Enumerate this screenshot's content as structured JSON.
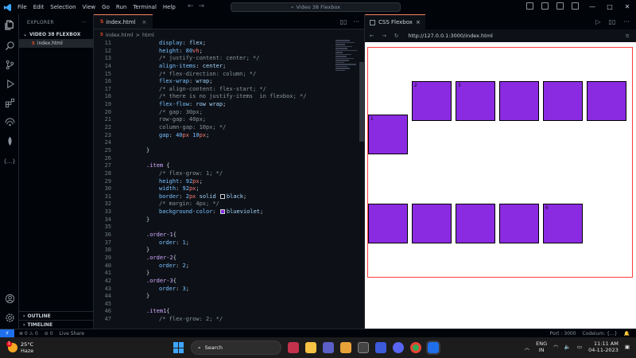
{
  "titlebar": {
    "menu": [
      "File",
      "Edit",
      "Selection",
      "View",
      "Go",
      "Run",
      "Terminal",
      "Help"
    ],
    "search_text": "Video 38 Flexbox",
    "nav_back": "←",
    "nav_forward": "→",
    "min_label": "—",
    "max_label": "□",
    "close_label": "✕"
  },
  "sidebar": {
    "header": "EXPLORER",
    "more": "···",
    "folder": "VIDEO 38 FLEXBOX",
    "file": "index.html",
    "file_badge": "5",
    "outline": "OUTLINE",
    "timeline": "TIMELINE"
  },
  "editor": {
    "tab_name": "index.html",
    "tab_close": "×",
    "tab_badge": "5",
    "crumb_file": "index.html",
    "crumb_sep": ">",
    "crumb_node": "html",
    "lines": [
      {
        "n": "11",
        "ind": 1,
        "parts": [
          [
            "prop",
            "display"
          ],
          [
            "pun",
            ": "
          ],
          [
            "val",
            "flex"
          ],
          [
            "pun",
            ";"
          ]
        ]
      },
      {
        "n": "12",
        "ind": 1,
        "parts": [
          [
            "prop",
            "height"
          ],
          [
            "pun",
            ": "
          ],
          [
            "num",
            "80"
          ],
          [
            "unit",
            "vh"
          ],
          [
            "pun",
            ";"
          ]
        ]
      },
      {
        "n": "13",
        "ind": 1,
        "parts": [
          [
            "cmt",
            "/* justify-content: center; */"
          ]
        ]
      },
      {
        "n": "14",
        "ind": 1,
        "parts": [
          [
            "prop",
            "align-items"
          ],
          [
            "pun",
            ": "
          ],
          [
            "val",
            "center"
          ],
          [
            "pun",
            ";"
          ]
        ]
      },
      {
        "n": "15",
        "ind": 1,
        "parts": [
          [
            "cmt",
            "/* flex-direction: column; */"
          ]
        ]
      },
      {
        "n": "16",
        "ind": 1,
        "parts": [
          [
            "prop",
            "flex-wrap"
          ],
          [
            "pun",
            ": "
          ],
          [
            "val",
            "wrap"
          ],
          [
            "pun",
            ";"
          ]
        ]
      },
      {
        "n": "17",
        "ind": 1,
        "parts": [
          [
            "cmt",
            "/* align-content: flex-start; */"
          ]
        ]
      },
      {
        "n": "18",
        "ind": 1,
        "parts": [
          [
            "cmt",
            "/* there is no justify-items  in flexbox; */"
          ]
        ]
      },
      {
        "n": "19",
        "ind": 1,
        "parts": [
          [
            "prop",
            "flex-flow"
          ],
          [
            "pun",
            ": "
          ],
          [
            "val",
            "row wrap"
          ],
          [
            "pun",
            ";"
          ]
        ]
      },
      {
        "n": "20",
        "ind": 1,
        "parts": [
          [
            "cmt",
            "/* gap: 30px;"
          ]
        ]
      },
      {
        "n": "21",
        "ind": 1,
        "parts": [
          [
            "cmt",
            "row-gap: 40px;"
          ]
        ]
      },
      {
        "n": "22",
        "ind": 1,
        "parts": [
          [
            "cmt",
            "column-gap: 10px; */"
          ]
        ]
      },
      {
        "n": "23",
        "ind": 1,
        "parts": [
          [
            "prop",
            "gap"
          ],
          [
            "pun",
            ": "
          ],
          [
            "num",
            "40"
          ],
          [
            "unit",
            "px"
          ],
          [
            "pun",
            " "
          ],
          [
            "num",
            "10"
          ],
          [
            "unit",
            "px"
          ],
          [
            "pun",
            ";"
          ]
        ]
      },
      {
        "n": "24",
        "ind": 0,
        "parts": []
      },
      {
        "n": "25",
        "ind": 0,
        "parts": [
          [
            "pun",
            "}"
          ]
        ]
      },
      {
        "n": "26",
        "ind": 0,
        "parts": []
      },
      {
        "n": "27",
        "ind": 0,
        "parts": [
          [
            "sel",
            ".item"
          ],
          [
            "pun",
            " {"
          ]
        ]
      },
      {
        "n": "28",
        "ind": 1,
        "parts": [
          [
            "cmt",
            "/* flex-grow: 1; */"
          ]
        ]
      },
      {
        "n": "29",
        "ind": 1,
        "parts": [
          [
            "prop",
            "height"
          ],
          [
            "pun",
            ": "
          ],
          [
            "num",
            "92"
          ],
          [
            "unit",
            "px"
          ],
          [
            "pun",
            ";"
          ]
        ]
      },
      {
        "n": "30",
        "ind": 1,
        "parts": [
          [
            "prop",
            "width"
          ],
          [
            "pun",
            ": "
          ],
          [
            "num",
            "92"
          ],
          [
            "unit",
            "px"
          ],
          [
            "pun",
            ";"
          ]
        ]
      },
      {
        "n": "31",
        "ind": 1,
        "parts": [
          [
            "prop",
            "border"
          ],
          [
            "pun",
            ": "
          ],
          [
            "num",
            "2"
          ],
          [
            "unit",
            "px"
          ],
          [
            "pun",
            " "
          ],
          [
            "val",
            "solid "
          ],
          [
            "sw",
            "#000000"
          ],
          [
            "val",
            "black"
          ],
          [
            "pun",
            ";"
          ]
        ]
      },
      {
        "n": "32",
        "ind": 1,
        "parts": [
          [
            "cmt",
            "/* margin: 4px; */"
          ]
        ]
      },
      {
        "n": "33",
        "ind": 1,
        "parts": [
          [
            "prop",
            "background-color"
          ],
          [
            "pun",
            ": "
          ],
          [
            "sw",
            "#8a2be2"
          ],
          [
            "val",
            "blueviolet"
          ],
          [
            "pun",
            ";"
          ]
        ]
      },
      {
        "n": "34",
        "ind": 0,
        "parts": [
          [
            "pun",
            "}"
          ]
        ]
      },
      {
        "n": "35",
        "ind": 0,
        "parts": []
      },
      {
        "n": "36",
        "ind": 0,
        "parts": [
          [
            "sel",
            ".order-1"
          ],
          [
            "pun",
            "{"
          ]
        ]
      },
      {
        "n": "37",
        "ind": 1,
        "parts": [
          [
            "prop",
            "order"
          ],
          [
            "pun",
            ": "
          ],
          [
            "num",
            "1"
          ],
          [
            "pun",
            ";"
          ]
        ]
      },
      {
        "n": "38",
        "ind": 0,
        "parts": [
          [
            "pun",
            "}"
          ]
        ]
      },
      {
        "n": "39",
        "ind": 0,
        "parts": [
          [
            "sel",
            ".order-2"
          ],
          [
            "pun",
            "{"
          ]
        ]
      },
      {
        "n": "40",
        "ind": 1,
        "parts": [
          [
            "prop",
            "order"
          ],
          [
            "pun",
            ": "
          ],
          [
            "num",
            "2"
          ],
          [
            "pun",
            ";"
          ]
        ]
      },
      {
        "n": "41",
        "ind": 0,
        "parts": [
          [
            "pun",
            "}"
          ]
        ]
      },
      {
        "n": "42",
        "ind": 0,
        "parts": [
          [
            "sel",
            ".order-3"
          ],
          [
            "pun",
            "{"
          ]
        ]
      },
      {
        "n": "43",
        "ind": 1,
        "parts": [
          [
            "prop",
            "order"
          ],
          [
            "pun",
            ": "
          ],
          [
            "num",
            "3"
          ],
          [
            "pun",
            ";"
          ]
        ]
      },
      {
        "n": "44",
        "ind": 0,
        "parts": [
          [
            "pun",
            "}"
          ]
        ]
      },
      {
        "n": "45",
        "ind": 0,
        "parts": []
      },
      {
        "n": "46",
        "ind": 0,
        "parts": [
          [
            "sel",
            ".item1"
          ],
          [
            "pun",
            "{"
          ]
        ]
      },
      {
        "n": "47",
        "ind": 1,
        "parts": [
          [
            "cmt",
            "/* flex-grow: 2; */"
          ]
        ]
      }
    ]
  },
  "preview": {
    "tab_title": "CSS Flexbox",
    "tab_close": "×",
    "nav_back": "←",
    "nav_forward": "→",
    "reload": "↻",
    "url": "http://127.0.0.1:3000/index.html",
    "menu": "≡",
    "items": [
      {
        "label": "1"
      },
      {
        "label": "2"
      },
      {
        "label": "3"
      },
      {
        "label": ""
      },
      {
        "label": ""
      },
      {
        "label": ""
      },
      {
        "label": ""
      },
      {
        "label": ""
      },
      {
        "label": ""
      },
      {
        "label": ""
      },
      {
        "label": "6"
      }
    ],
    "item_color": "#8a2be2",
    "container_border": "#ff3b3b"
  },
  "statusbar": {
    "remote": "⚡",
    "errors": "⊗ 0 ⚠ 0",
    "ports": "⊘ 0",
    "live": "Live Share",
    "port": "Port : 3000",
    "codeium": "Codeium: {...}",
    "bell": "🔔"
  },
  "taskbar": {
    "weather_badge": "1",
    "temp": "25°C",
    "cond": "Haze",
    "search": "Search",
    "lang1": "ENG",
    "lang2": "IN",
    "time": "11:11 AM",
    "date": "04-11-2023",
    "tray_up": "︿"
  }
}
